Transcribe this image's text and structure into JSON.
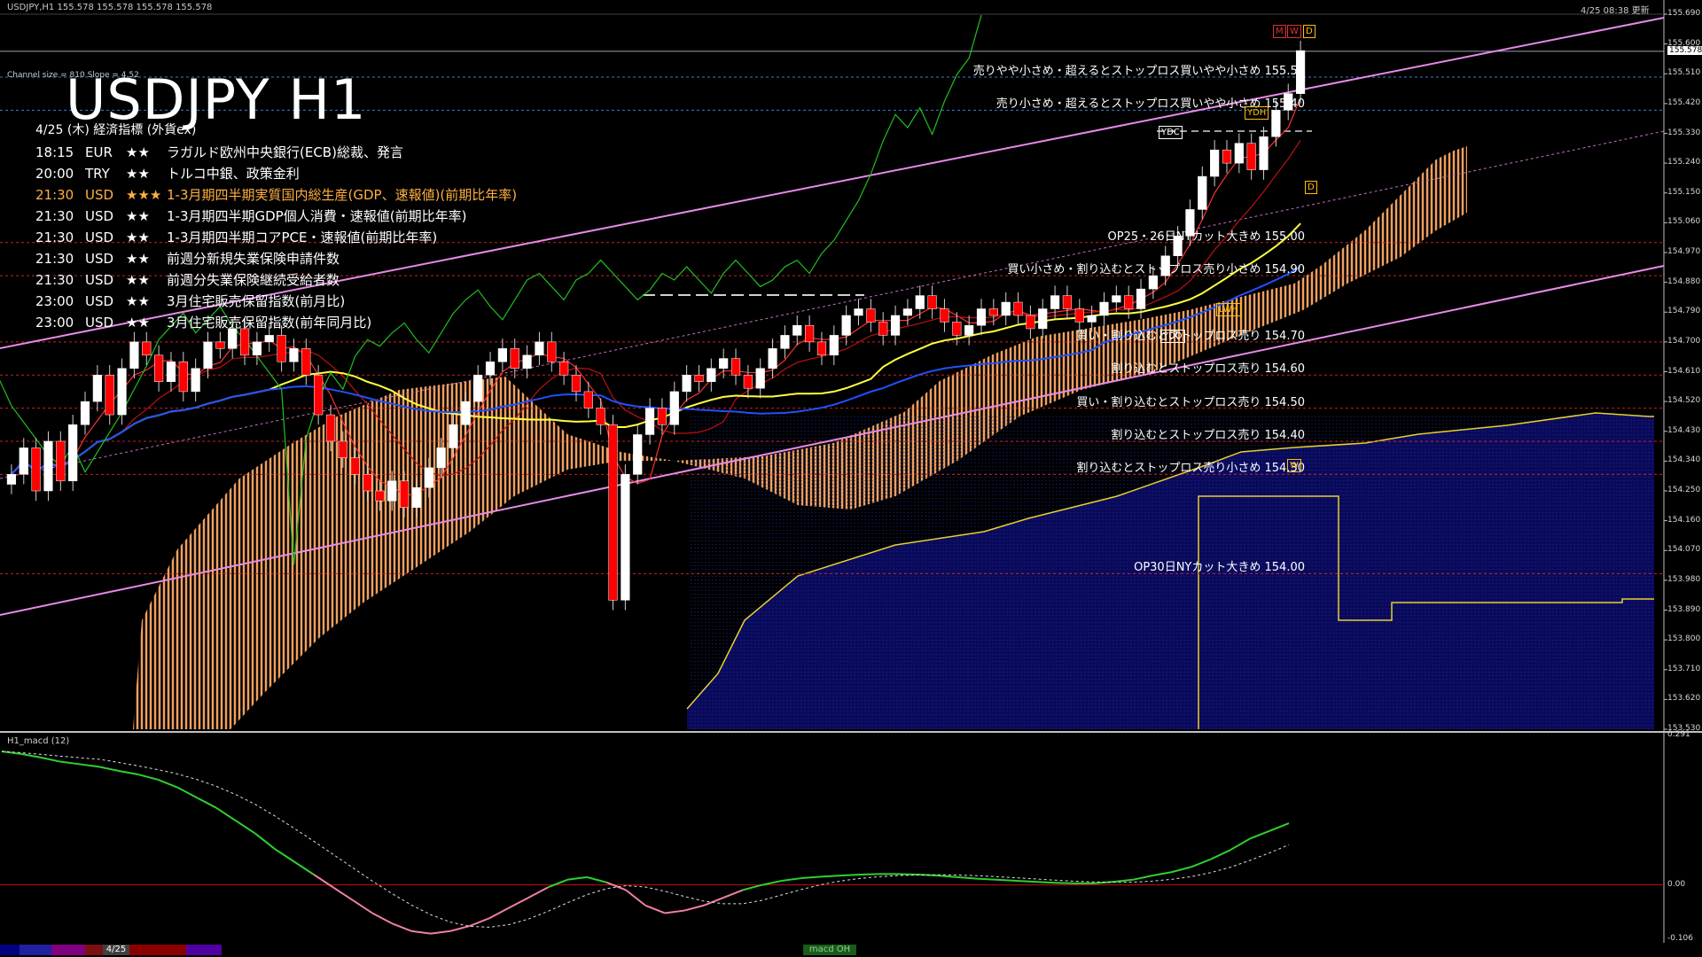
{
  "header": {
    "symbol_bar": "USDJPY,H1  155.578 155.578 155.578 155.578",
    "datetime": "4/25 08:38 更新",
    "channel_info": "Channel size = 810  Slope = 4.52"
  },
  "title": "USDJPY H1",
  "calendar": {
    "heading": "4/25 (木) 経済指標 (外貨ex)",
    "rows": [
      {
        "time": "18:15",
        "cur": "EUR",
        "stars": "★★",
        "event": "ラガルド欧州中央銀行(ECB)総裁、発言",
        "hi": false
      },
      {
        "time": "20:00",
        "cur": "TRY",
        "stars": "★★",
        "event": "トルコ中銀、政策金利",
        "hi": false
      },
      {
        "time": "21:30",
        "cur": "USD",
        "stars": "★★★",
        "event": "1-3月期四半期実質国内総生産(GDP、速報値)(前期比年率)",
        "hi": true
      },
      {
        "time": "21:30",
        "cur": "USD",
        "stars": "★★",
        "event": "1-3月期四半期GDP個人消費・速報値(前期比年率)",
        "hi": false
      },
      {
        "time": "21:30",
        "cur": "USD",
        "stars": "★★",
        "event": "1-3月期四半期コアPCE・速報値(前期比年率)",
        "hi": false
      },
      {
        "time": "21:30",
        "cur": "USD",
        "stars": "★★",
        "event": "前週分新規失業保険申請件数",
        "hi": false
      },
      {
        "time": "21:30",
        "cur": "USD",
        "stars": "★★",
        "event": "前週分失業保険継続受給者数",
        "hi": false
      },
      {
        "time": "23:00",
        "cur": "USD",
        "stars": "★★",
        "event": "3月住宅販売保留指数(前月比)",
        "hi": false
      },
      {
        "time": "23:00",
        "cur": "USD",
        "stars": "★★",
        "event": "3月住宅販売保留指数(前年同月比)",
        "hi": false
      }
    ]
  },
  "levels": [
    {
      "price": 155.5,
      "label": "売りやや小さめ・超えるとストップロス買いやや小さめ 155.50",
      "color": "#3a7bd5"
    },
    {
      "price": 155.4,
      "label": "売り小さめ・超えるとストップロス買いやや小さめ 155.40",
      "color": "#3a7bd5"
    },
    {
      "price": 155.0,
      "label": "OP25・26日NYカット大きめ 155.00",
      "color": "#cc2020"
    },
    {
      "price": 154.9,
      "label": "買い小さめ・割り込むとストップロス売り小さめ 154.90",
      "color": "#cc2020"
    },
    {
      "price": 154.7,
      "label": "買い・割り込むとストップロス売り 154.70",
      "color": "#cc2020"
    },
    {
      "price": 154.6,
      "label": "割り込むとストップロス売り 154.60",
      "color": "#cc2020"
    },
    {
      "price": 154.5,
      "label": "買い・割り込むとストップロス売り 154.50",
      "color": "#cc2020"
    },
    {
      "price": 154.4,
      "label": "割り込むとストップロス売り 154.40",
      "color": "#cc2020"
    },
    {
      "price": 154.3,
      "label": "割り込むとストップロス売り小さめ 154.30",
      "color": "#cc2020"
    },
    {
      "price": 154.0,
      "label": "OP30日NYカット大きめ 154.00",
      "color": "#cc2020"
    }
  ],
  "markers": {
    "m": "M",
    "w": "W",
    "d": "D",
    "ydh": "YDH",
    "ydc": "YDC",
    "lwh": "LWH",
    "ydo": "YDO",
    "w2": "W",
    "d2": "D"
  },
  "macd_label": "H1_macd (12)",
  "tab_date": "4/25",
  "tab_macd": "macd OH",
  "chart_data": {
    "type": "line",
    "title": "USDJPY H1",
    "symbol": "USDJPY",
    "timeframe": "H1",
    "last_price": 155.578,
    "ylim": [
      153.53,
      155.69
    ],
    "yticks": [
      155.69,
      155.6,
      155.51,
      155.42,
      155.33,
      155.24,
      155.15,
      155.06,
      154.97,
      154.88,
      154.79,
      154.7,
      154.61,
      154.52,
      154.43,
      154.34,
      154.25,
      154.16,
      154.07,
      153.98,
      153.89,
      153.8,
      153.71,
      153.62,
      153.53
    ],
    "ytick_labels": [
      "155.690",
      "155.600",
      "155.510",
      "155.420",
      "155.330",
      "155.240",
      "155.150",
      "155.060",
      "154.970",
      "154.880",
      "154.790",
      "154.700",
      "154.610",
      "154.520",
      "154.430",
      "154.340",
      "154.250",
      "154.160",
      "154.070",
      "153.980",
      "153.890",
      "153.800",
      "153.710",
      "153.620",
      "153.530"
    ],
    "closes": [
      154.3,
      154.38,
      154.25,
      154.4,
      154.28,
      154.45,
      154.52,
      154.6,
      154.48,
      154.62,
      154.7,
      154.66,
      154.58,
      154.64,
      154.55,
      154.62,
      154.7,
      154.68,
      154.74,
      154.66,
      154.7,
      154.72,
      154.64,
      154.68,
      154.6,
      154.48,
      154.4,
      154.35,
      154.3,
      154.25,
      154.22,
      154.28,
      154.2,
      154.26,
      154.32,
      154.38,
      154.45,
      154.52,
      154.6,
      154.64,
      154.68,
      154.62,
      154.66,
      154.7,
      154.64,
      154.6,
      154.55,
      154.5,
      154.45,
      153.92,
      154.3,
      154.42,
      154.5,
      154.45,
      154.55,
      154.6,
      154.58,
      154.62,
      154.65,
      154.6,
      154.56,
      154.62,
      154.68,
      154.72,
      154.75,
      154.7,
      154.66,
      154.72,
      154.78,
      154.8,
      154.76,
      154.72,
      154.78,
      154.8,
      154.84,
      154.8,
      154.76,
      154.72,
      154.75,
      154.8,
      154.78,
      154.82,
      154.78,
      154.74,
      154.8,
      154.84,
      154.8,
      154.76,
      154.78,
      154.82,
      154.84,
      154.8,
      154.86,
      154.9,
      154.96,
      155.02,
      155.1,
      155.2,
      155.28,
      155.24,
      155.3,
      155.22,
      155.32,
      155.4,
      155.45,
      155.58
    ],
    "macd_ylim": [
      -0.106,
      0.291
    ],
    "macd_ytick_labels": [
      "0.291",
      "0.00",
      "-0.106"
    ],
    "macd": [
      0.26,
      0.255,
      0.248,
      0.24,
      0.235,
      0.23,
      0.222,
      0.215,
      0.205,
      0.19,
      0.17,
      0.15,
      0.125,
      0.1,
      0.07,
      0.045,
      0.02,
      -0.005,
      -0.03,
      -0.055,
      -0.075,
      -0.09,
      -0.095,
      -0.09,
      -0.08,
      -0.065,
      -0.045,
      -0.025,
      -0.005,
      0.01,
      0.015,
      0.005,
      -0.01,
      -0.04,
      -0.055,
      -0.05,
      -0.04,
      -0.025,
      -0.01,
      0.0,
      0.008,
      0.013,
      0.016,
      0.018,
      0.02,
      0.021,
      0.021,
      0.02,
      0.018,
      0.015,
      0.012,
      0.01,
      0.008,
      0.006,
      0.004,
      0.003,
      0.003,
      0.006,
      0.01,
      0.018,
      0.025,
      0.035,
      0.05,
      0.068,
      0.09,
      0.105,
      0.12
    ]
  }
}
